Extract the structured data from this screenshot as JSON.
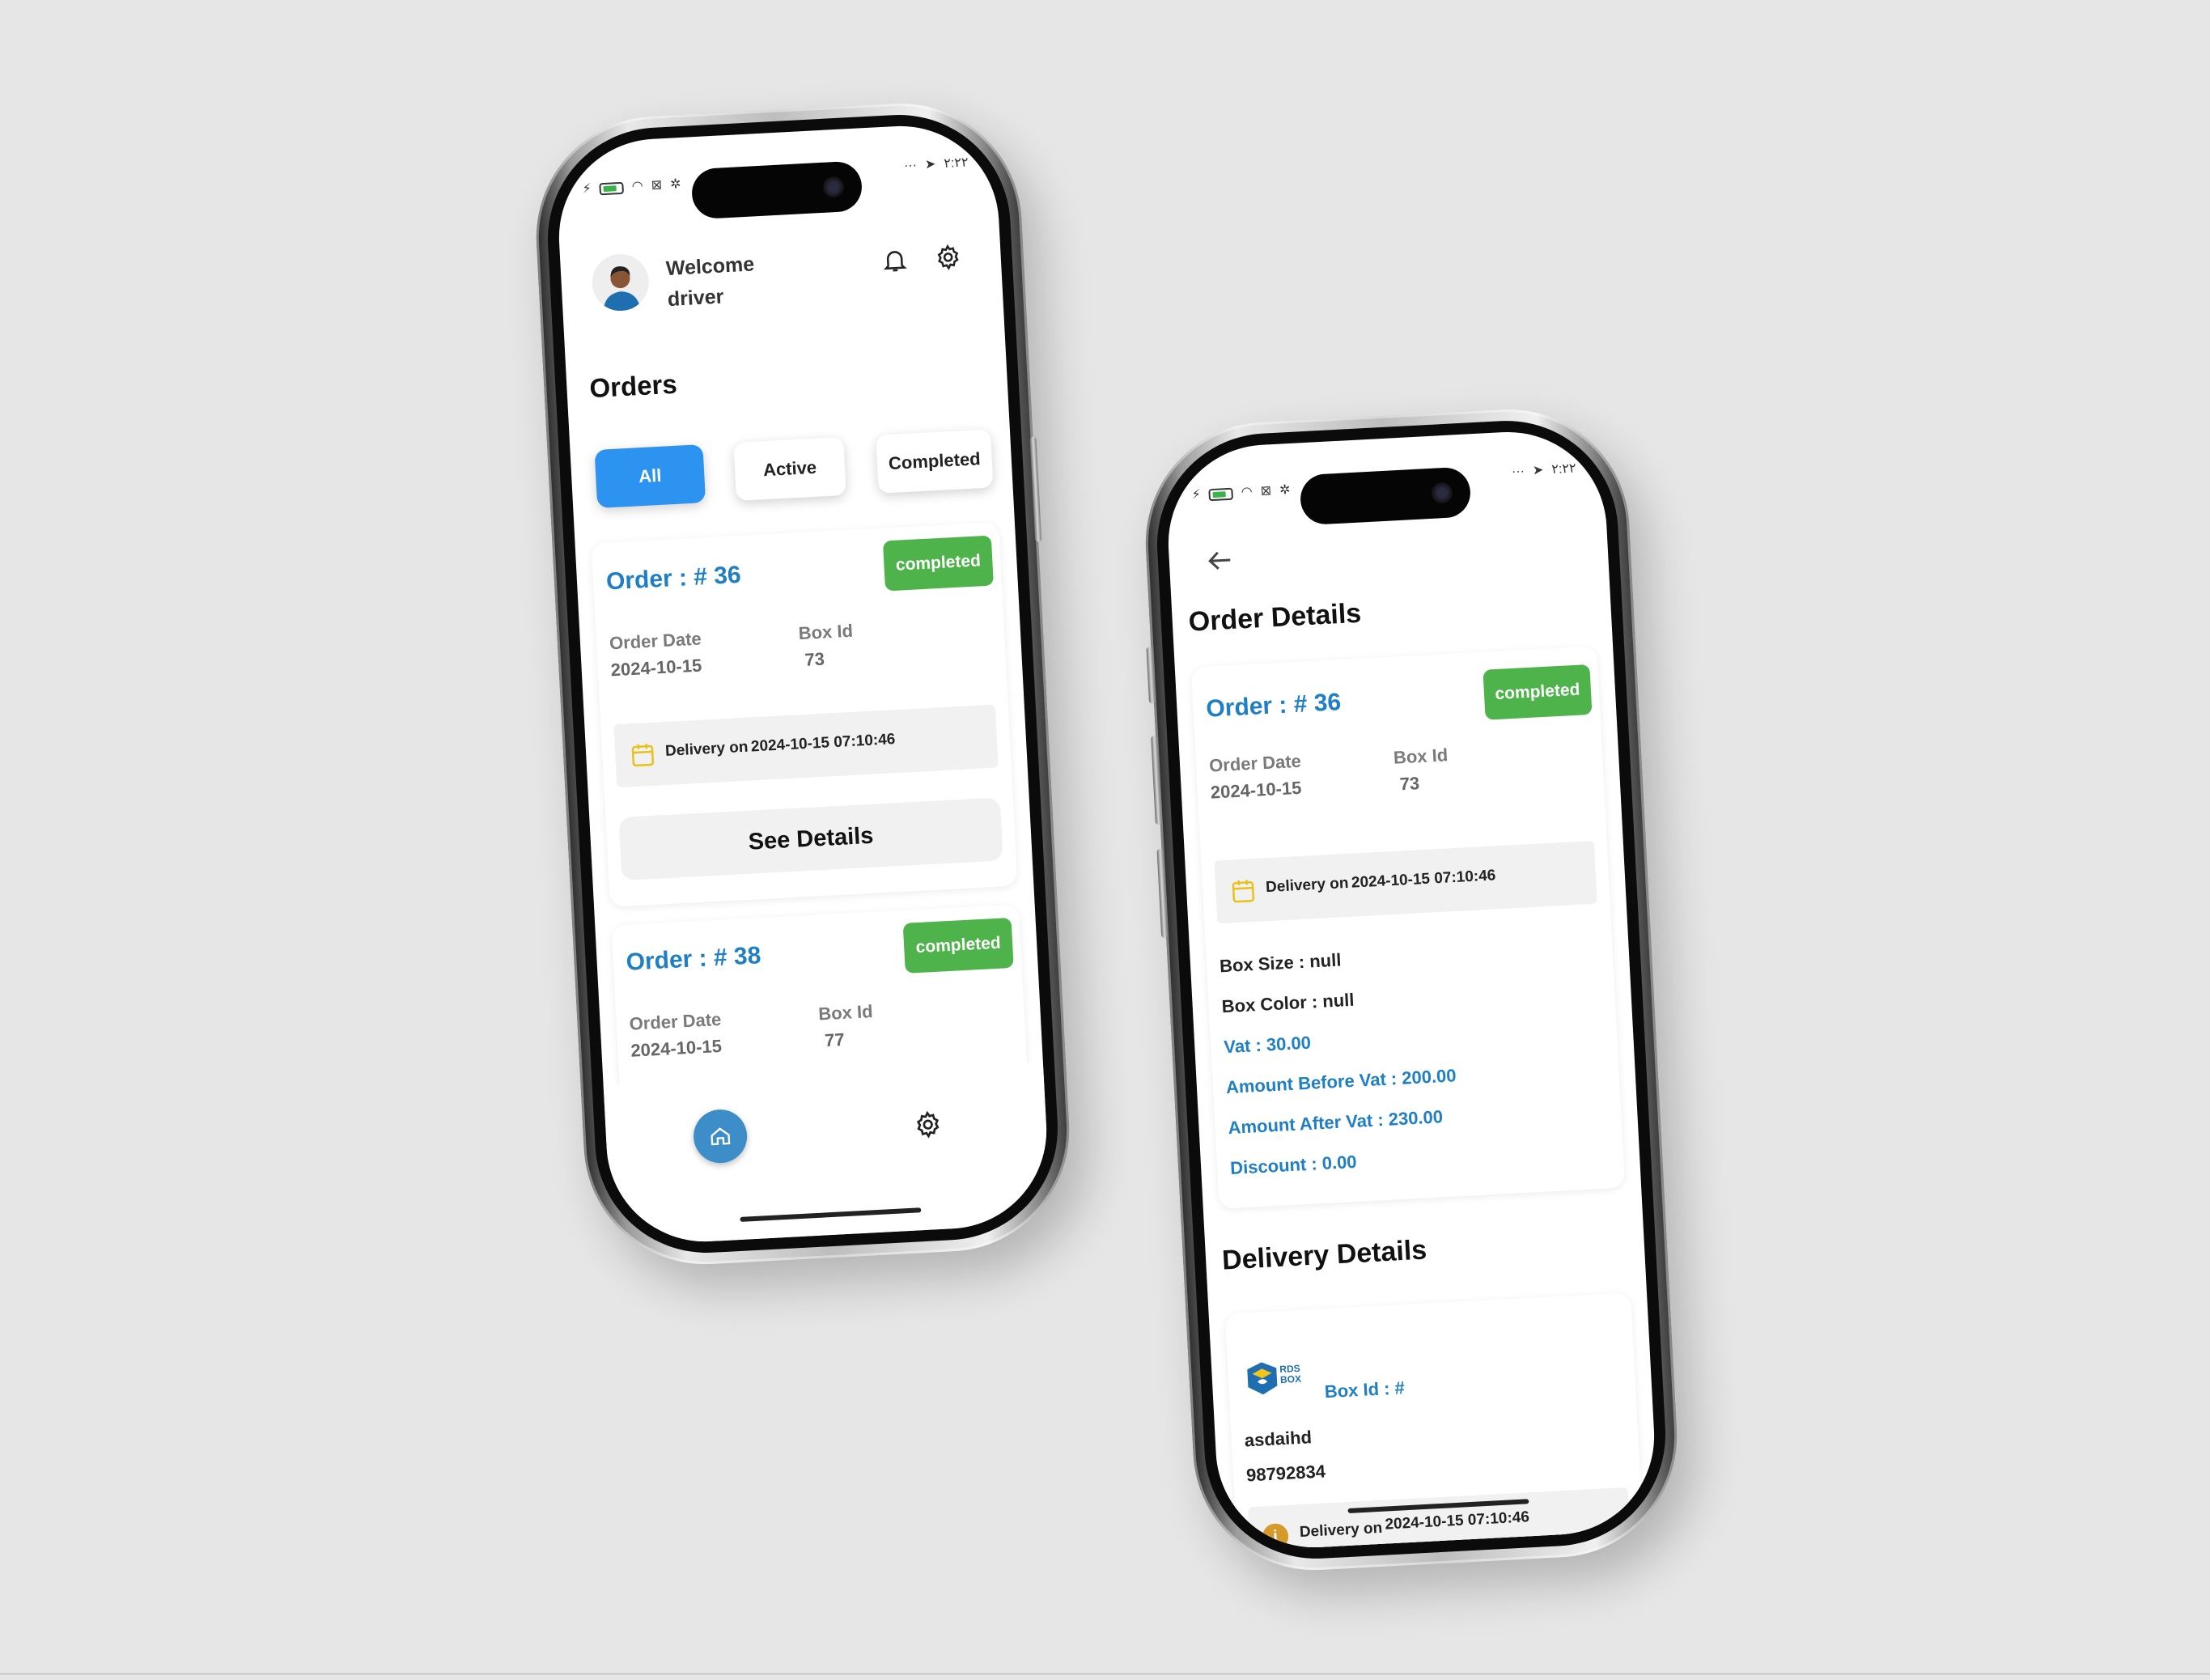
{
  "status_bar": {
    "time": "٢:٢٢",
    "dots": "···"
  },
  "orders_screen": {
    "welcome_line1": "Welcome",
    "welcome_line2": "driver",
    "title": "Orders",
    "tabs": [
      {
        "label": "All",
        "selected": true
      },
      {
        "label": "Active",
        "selected": false
      },
      {
        "label": "Completed",
        "selected": false
      }
    ],
    "orders": [
      {
        "number": "Order : # 36",
        "status": "completed",
        "order_date_label": "Order Date",
        "order_date": "2024-10-15",
        "box_id_label": "Box Id",
        "box_id": "73",
        "delivery_label": "Delivery on",
        "delivery_value": "2024-10-15 07:10:46",
        "button": "See Details"
      },
      {
        "number": "Order : # 38",
        "status": "completed",
        "order_date_label": "Order Date",
        "order_date": "2024-10-15",
        "box_id_label": "Box Id",
        "box_id": "77"
      }
    ]
  },
  "details_screen": {
    "title": "Order Details",
    "order": {
      "number": "Order : # 36",
      "status": "completed",
      "order_date_label": "Order Date",
      "order_date": "2024-10-15",
      "box_id_label": "Box Id",
      "box_id": "73",
      "delivery_label": "Delivery on",
      "delivery_value": "2024-10-15 07:10:46",
      "box_size": "Box Size : null",
      "box_color": "Box Color : null",
      "vat": "Vat : 30.00",
      "amount_before_vat": "Amount Before Vat : 200.00",
      "amount_after_vat": "Amount After Vat : 230.00",
      "discount": "Discount : 0.00"
    },
    "delivery_title": "Delivery Details",
    "delivery": {
      "logo_text": "RDS BOX",
      "box_id_link": "Box Id : #",
      "name": "asdaihd",
      "phone": "98792834",
      "delivery_label": "Delivery on",
      "delivery_value": "2024-10-15 07:10:46"
    }
  },
  "colors": {
    "background": "#e6e6e6",
    "accent_blue": "#2d93f0",
    "link_blue": "#1f7fc4",
    "status_green": "#4db34a",
    "calendar_yellow": "#e8c21a"
  }
}
